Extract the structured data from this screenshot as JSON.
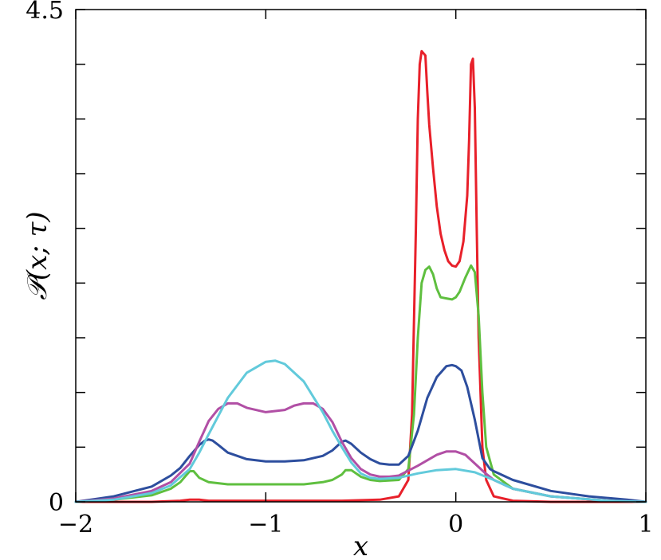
{
  "chart_data": {
    "type": "line",
    "title": "",
    "xlabel": "x",
    "ylabel": "𝒫(x; τ)",
    "xlim": [
      -2,
      1
    ],
    "ylim": [
      0,
      4.5
    ],
    "x_tick_values": [
      -2,
      -1,
      0,
      1
    ],
    "x_tick_labels": [
      "−2",
      "−1",
      "0",
      "1"
    ],
    "y_tick_values": [
      0,
      0.5,
      1,
      1.5,
      2,
      2.5,
      3,
      3.5,
      4,
      4.5
    ],
    "y_tick_labels": [
      "0",
      "",
      "",
      "",
      "",
      "",
      "",
      "",
      "",
      "4.5"
    ],
    "grid": false,
    "series": [
      {
        "color": "#e8202a",
        "x": [
          -2,
          -1.6,
          -1.45,
          -1.4,
          -1.35,
          -1.3,
          -1.0,
          -0.6,
          -0.4,
          -0.3,
          -0.25,
          -0.23,
          -0.21,
          -0.2,
          -0.19,
          -0.18,
          -0.16,
          -0.15,
          -0.14,
          -0.12,
          -0.1,
          -0.08,
          -0.06,
          -0.04,
          -0.02,
          0,
          0.02,
          0.04,
          0.06,
          0.07,
          0.08,
          0.09,
          0.1,
          0.11,
          0.12,
          0.14,
          0.16,
          0.2,
          0.3,
          0.5,
          1.0
        ],
        "y": [
          0,
          0,
          0.01,
          0.02,
          0.02,
          0.01,
          0.01,
          0.01,
          0.02,
          0.05,
          0.2,
          0.8,
          2.5,
          3.5,
          4.0,
          4.12,
          4.08,
          3.75,
          3.45,
          3.05,
          2.7,
          2.45,
          2.3,
          2.2,
          2.16,
          2.15,
          2.2,
          2.38,
          2.8,
          3.3,
          4.0,
          4.05,
          3.6,
          2.5,
          1.5,
          0.5,
          0.2,
          0.05,
          0.01,
          0,
          0
        ]
      },
      {
        "color": "#5fbf3f",
        "x": [
          -2,
          -1.8,
          -1.6,
          -1.5,
          -1.45,
          -1.42,
          -1.4,
          -1.38,
          -1.35,
          -1.3,
          -1.2,
          -1.0,
          -0.8,
          -0.7,
          -0.65,
          -0.6,
          -0.58,
          -0.55,
          -0.5,
          -0.45,
          -0.4,
          -0.3,
          -0.25,
          -0.22,
          -0.2,
          -0.18,
          -0.16,
          -0.14,
          -0.12,
          -0.1,
          -0.08,
          -0.05,
          -0.02,
          0,
          0.02,
          0.05,
          0.08,
          0.1,
          0.12,
          0.14,
          0.16,
          0.2,
          0.3,
          0.5,
          0.8,
          1.0
        ],
        "y": [
          0,
          0.02,
          0.06,
          0.12,
          0.18,
          0.24,
          0.28,
          0.28,
          0.22,
          0.18,
          0.16,
          0.16,
          0.16,
          0.18,
          0.2,
          0.25,
          0.29,
          0.29,
          0.23,
          0.2,
          0.19,
          0.2,
          0.3,
          0.8,
          1.5,
          2.0,
          2.12,
          2.15,
          2.08,
          1.95,
          1.87,
          1.86,
          1.85,
          1.87,
          1.92,
          2.05,
          2.16,
          2.1,
          1.7,
          1.0,
          0.5,
          0.25,
          0.12,
          0.05,
          0.01,
          0
        ]
      },
      {
        "color": "#2d4e9e",
        "x": [
          -2,
          -1.8,
          -1.6,
          -1.5,
          -1.45,
          -1.4,
          -1.35,
          -1.32,
          -1.3,
          -1.28,
          -1.25,
          -1.2,
          -1.1,
          -1.0,
          -0.9,
          -0.8,
          -0.7,
          -0.65,
          -0.6,
          -0.58,
          -0.55,
          -0.5,
          -0.45,
          -0.4,
          -0.35,
          -0.3,
          -0.25,
          -0.2,
          -0.15,
          -0.1,
          -0.05,
          -0.02,
          0,
          0.03,
          0.06,
          0.1,
          0.14,
          0.18,
          0.2,
          0.3,
          0.5,
          0.7,
          0.9,
          1.0
        ],
        "y": [
          0,
          0.05,
          0.14,
          0.24,
          0.31,
          0.42,
          0.52,
          0.56,
          0.57,
          0.56,
          0.52,
          0.45,
          0.39,
          0.37,
          0.37,
          0.38,
          0.42,
          0.47,
          0.55,
          0.56,
          0.53,
          0.45,
          0.39,
          0.35,
          0.34,
          0.34,
          0.42,
          0.65,
          0.95,
          1.14,
          1.24,
          1.25,
          1.24,
          1.2,
          1.05,
          0.75,
          0.4,
          0.3,
          0.28,
          0.2,
          0.1,
          0.05,
          0.02,
          0
        ]
      },
      {
        "color": "#b14fa5",
        "x": [
          -2,
          -1.8,
          -1.6,
          -1.5,
          -1.4,
          -1.35,
          -1.3,
          -1.25,
          -1.2,
          -1.15,
          -1.1,
          -1.0,
          -0.9,
          -0.85,
          -0.8,
          -0.75,
          -0.7,
          -0.65,
          -0.6,
          -0.55,
          -0.5,
          -0.45,
          -0.4,
          -0.35,
          -0.3,
          -0.2,
          -0.1,
          -0.05,
          0,
          0.05,
          0.1,
          0.15,
          0.2,
          0.3,
          0.5,
          0.8,
          1.0
        ],
        "y": [
          0,
          0.03,
          0.1,
          0.18,
          0.35,
          0.55,
          0.74,
          0.85,
          0.9,
          0.9,
          0.86,
          0.82,
          0.84,
          0.88,
          0.9,
          0.9,
          0.85,
          0.73,
          0.55,
          0.4,
          0.3,
          0.25,
          0.23,
          0.23,
          0.24,
          0.33,
          0.43,
          0.46,
          0.46,
          0.43,
          0.35,
          0.27,
          0.2,
          0.12,
          0.05,
          0.01,
          0
        ]
      },
      {
        "color": "#62cadb",
        "x": [
          -2,
          -1.8,
          -1.6,
          -1.5,
          -1.4,
          -1.35,
          -1.3,
          -1.2,
          -1.1,
          -1.0,
          -0.95,
          -0.9,
          -0.8,
          -0.7,
          -0.65,
          -0.6,
          -0.55,
          -0.5,
          -0.45,
          -0.4,
          -0.3,
          -0.2,
          -0.1,
          0,
          0.1,
          0.2,
          0.3,
          0.5,
          0.8,
          1.0
        ],
        "y": [
          0,
          0.02,
          0.08,
          0.15,
          0.3,
          0.45,
          0.62,
          0.95,
          1.18,
          1.28,
          1.29,
          1.26,
          1.1,
          0.82,
          0.65,
          0.5,
          0.36,
          0.26,
          0.22,
          0.21,
          0.22,
          0.26,
          0.29,
          0.3,
          0.27,
          0.2,
          0.12,
          0.05,
          0.01,
          0
        ]
      }
    ]
  }
}
